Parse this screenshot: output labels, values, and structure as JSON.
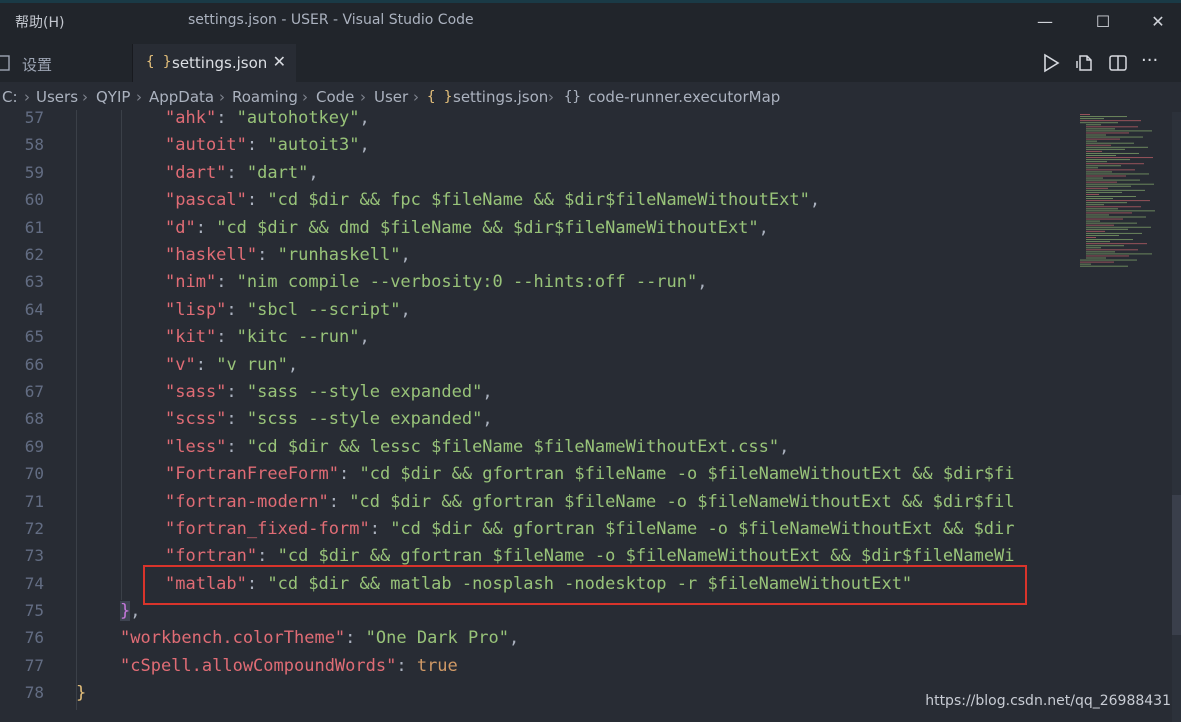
{
  "window": {
    "menu_label": "帮助(H)",
    "title": "settings.json - USER - Visual Studio Code",
    "minimize": "—",
    "maximize": "☐",
    "close": "✕"
  },
  "tabs": [
    {
      "label": "设置",
      "icon": "settings-file-icon"
    },
    {
      "label": "settings.json",
      "icon": "json-braces-icon",
      "close": "✕"
    }
  ],
  "editor_actions": [
    "run-icon",
    "open-settings-icon",
    "split-editor-icon",
    "more-actions-icon"
  ],
  "actions_more": "···",
  "breadcrumb": {
    "c": "C:",
    "users": "Users",
    "qyip": "QYIP",
    "appdata": "AppData",
    "roaming": "Roaming",
    "code": "Code",
    "user": "User",
    "file_icon": "{ }",
    "file": "settings.json",
    "sym_icon": "{}",
    "symbol": "code-runner.executorMap",
    "sep": "›"
  },
  "lines": [
    {
      "n": "57",
      "k": "\"ahk\"",
      "v": "\"autohotkey\"",
      "t": ","
    },
    {
      "n": "58",
      "k": "\"autoit\"",
      "v": "\"autoit3\"",
      "t": ","
    },
    {
      "n": "59",
      "k": "\"dart\"",
      "v": "\"dart\"",
      "t": ","
    },
    {
      "n": "60",
      "k": "\"pascal\"",
      "v": "\"cd $dir && fpc $fileName && $dir$fileNameWithoutExt\"",
      "t": ","
    },
    {
      "n": "61",
      "k": "\"d\"",
      "v": "\"cd $dir && dmd $fileName && $dir$fileNameWithoutExt\"",
      "t": ","
    },
    {
      "n": "62",
      "k": "\"haskell\"",
      "v": "\"runhaskell\"",
      "t": ","
    },
    {
      "n": "63",
      "k": "\"nim\"",
      "v": "\"nim compile --verbosity:0 --hints:off --run\"",
      "t": ","
    },
    {
      "n": "64",
      "k": "\"lisp\"",
      "v": "\"sbcl --script\"",
      "t": ","
    },
    {
      "n": "65",
      "k": "\"kit\"",
      "v": "\"kitc --run\"",
      "t": ","
    },
    {
      "n": "66",
      "k": "\"v\"",
      "v": "\"v run\"",
      "t": ","
    },
    {
      "n": "67",
      "k": "\"sass\"",
      "v": "\"sass --style expanded\"",
      "t": ","
    },
    {
      "n": "68",
      "k": "\"scss\"",
      "v": "\"scss --style expanded\"",
      "t": ","
    },
    {
      "n": "69",
      "k": "\"less\"",
      "v": "\"cd $dir && lessc $fileName $fileNameWithoutExt.css\"",
      "t": ","
    },
    {
      "n": "70",
      "k": "\"FortranFreeForm\"",
      "v": "\"cd $dir && gfortran $fileName -o $fileNameWithoutExt && $dir$fi",
      "t": ""
    },
    {
      "n": "71",
      "k": "\"fortran-modern\"",
      "v": "\"cd $dir && gfortran $fileName -o $fileNameWithoutExt && $dir$fil",
      "t": ""
    },
    {
      "n": "72",
      "k": "\"fortran_fixed-form\"",
      "v": "\"cd $dir && gfortran $fileName -o $fileNameWithoutExt && $dir",
      "t": ""
    },
    {
      "n": "73",
      "k": "\"fortran\"",
      "v": "\"cd $dir && gfortran $fileName -o $fileNameWithoutExt && $dir$fileNameWi",
      "t": ""
    },
    {
      "n": "74",
      "k": "\"matlab\"",
      "v": "\"cd $dir && matlab -nosplash -nodesktop -r $fileNameWithoutExt\"",
      "t": ""
    }
  ],
  "line75": {
    "n": "75",
    "brace": "}",
    "t": ","
  },
  "line76": {
    "n": "76",
    "k": "\"workbench.colorTheme\"",
    "v": "\"One Dark Pro\"",
    "t": ","
  },
  "line77": {
    "n": "77",
    "k": "\"cSpell.allowCompoundWords\"",
    "v": "true"
  },
  "line78": {
    "n": "78",
    "brace": "}"
  },
  "colon": ": ",
  "watermark": "https://blog.csdn.net/qq_26988431",
  "colors": {
    "key": "#e06c75",
    "string": "#98c379",
    "literal": "#d19a66",
    "highlight_box": "#d9342b"
  }
}
